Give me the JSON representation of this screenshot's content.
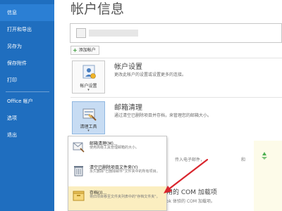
{
  "sidebar": {
    "items": [
      {
        "label": "信息",
        "selected": true
      },
      {
        "label": "打开和导出"
      },
      {
        "label": "另存为"
      },
      {
        "label": "保存附件"
      },
      {
        "label": "打印"
      },
      {
        "label": "Office 帐户"
      },
      {
        "label": "选项"
      },
      {
        "label": "退出"
      }
    ]
  },
  "page": {
    "title": "帐户信息"
  },
  "account": {
    "add_label": "添加帐户"
  },
  "sections": [
    {
      "tile_label": "帐户设置",
      "heading": "帐户设置",
      "desc": "更改此帐户的设置或设置更多的连接。"
    },
    {
      "tile_label": "清理工具",
      "heading": "邮箱清理",
      "desc": "通过清空已删除项目并存档，来管理您的邮箱大小。"
    }
  ],
  "menu": {
    "items": [
      {
        "title": "邮箱清理(M)...",
        "desc": "使用高级工具管理邮箱的大小。"
      },
      {
        "title": "清空已删除项目文件夹(Y)",
        "desc": "永久删除\"已删除邮件\"文件夹中的所有项目。"
      },
      {
        "title": "存档(I)...",
        "desc": "将旧项目移至文件夹列表中的\"存档文件夹\"。"
      }
    ]
  },
  "background": {
    "behind_1": "传入电子邮件，",
    "behind_2": "和",
    "addin_heading": "用的 COM 加载项",
    "addin_desc": "ok 体验的 COM 加载项。"
  },
  "colors": {
    "sidebar_bg": "#1f6ebf",
    "hover_bg": "#fbeec0",
    "arrow": "#d9262e"
  }
}
